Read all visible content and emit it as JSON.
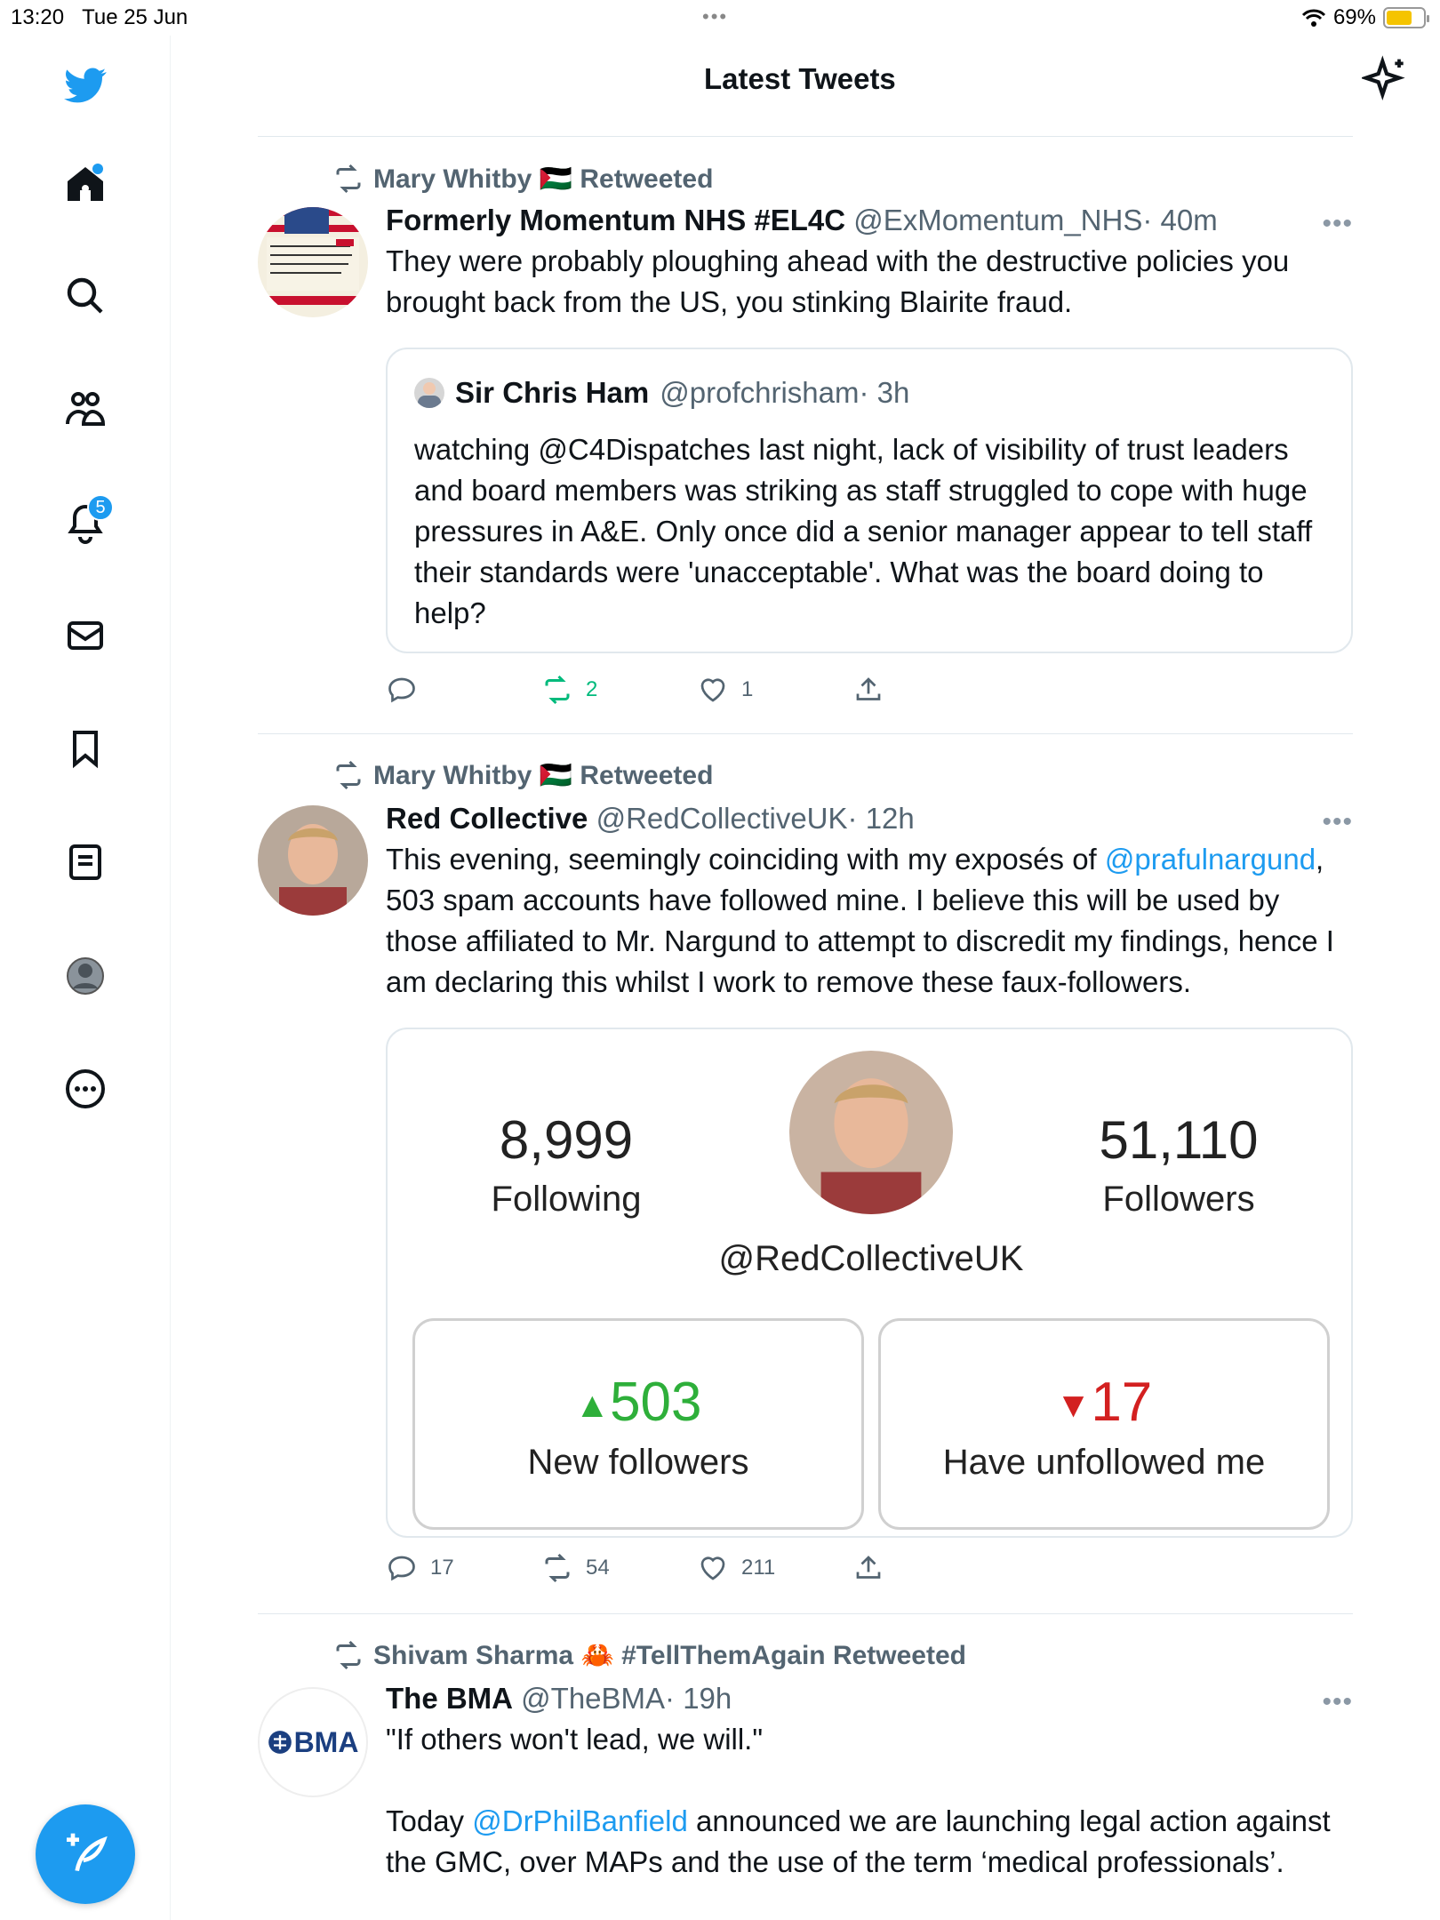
{
  "status_bar": {
    "time": "13:20",
    "date": "Tue 25 Jun",
    "battery": "69%",
    "battery_level": 0.69,
    "battery_color": "#f5c400"
  },
  "header": {
    "title": "Latest Tweets",
    "sparkle_icon": "sparkle-icon"
  },
  "sidebar": {
    "items": [
      {
        "name": "twitter-logo",
        "icon": "bird-icon"
      },
      {
        "name": "home",
        "icon": "home-icon",
        "has_dot": true
      },
      {
        "name": "search",
        "icon": "search-icon"
      },
      {
        "name": "communities",
        "icon": "people-icon"
      },
      {
        "name": "notifications",
        "icon": "bell-icon",
        "badge": "5"
      },
      {
        "name": "messages",
        "icon": "mail-icon"
      },
      {
        "name": "bookmarks",
        "icon": "bookmark-icon"
      },
      {
        "name": "lists",
        "icon": "list-icon"
      },
      {
        "name": "profile",
        "icon": "profile-icon"
      },
      {
        "name": "more",
        "icon": "more-circle-icon"
      }
    ],
    "compose_icon": "feather-plus-icon"
  },
  "colors": {
    "accent": "#1d9bf0",
    "green": "#00ba7c",
    "red": "#d32020",
    "stat_green": "#2eaf3a"
  },
  "tweets": [
    {
      "retweeted_by": "Mary Whitby 🇵🇸 Retweeted",
      "name": "Formerly Momentum NHS #EL4C",
      "handle": "@ExMomentum_NHS",
      "time": "· 40m",
      "text": "They were probably ploughing ahead with the destructive policies you brought back from the US, you stinking Blairite fraud.",
      "quote": {
        "name": "Sir Chris Ham",
        "handle": "@profchrisham",
        "time": "· 3h",
        "text": "watching @C4Dispatches last night, lack of visibility of trust leaders and board members was striking as staff struggled to cope with huge pressures in A&E. Only once did a senior manager appear to tell staff their standards were 'unacceptable'. What was the board doing to help?"
      },
      "replies": "",
      "retweets": "2",
      "likes": "1"
    },
    {
      "retweeted_by": "Mary Whitby 🇵🇸 Retweeted",
      "name": "Red Collective",
      "handle": "@RedCollectiveUK",
      "time": "· 12h",
      "text_before": "This evening, seemingly coinciding with my exposés of ",
      "mention": "@prafulnargund",
      "text_after": ", 503 spam accounts have followed mine. I believe this will be used by those affiliated to Mr. Nargund to attempt to discredit my findings, hence I am declaring this whilst I work to remove these faux-followers.",
      "card": {
        "following_num": "8,999",
        "following_label": "Following",
        "followers_num": "51,110",
        "followers_label": "Followers",
        "handle": "@RedCollectiveUK",
        "new_followers_num": "503",
        "new_followers_label": "New followers",
        "unfollowed_num": "17",
        "unfollowed_label": "Have unfollowed me"
      },
      "replies": "17",
      "retweets": "54",
      "likes": "211"
    },
    {
      "retweeted_by": "Shivam Sharma 🦀 #TellThemAgain Retweeted",
      "name": "The BMA",
      "handle": "@TheBMA",
      "time": "· 19h",
      "avatar_text": "BMA",
      "text_line1": "\"If others won't lead, we will.\"",
      "text2_before": "Today ",
      "mention": "@DrPhilBanfield",
      "text2_after": " announced we are launching legal action against the GMC, over MAPs and the use of the term ‘medical professionals’."
    }
  ]
}
